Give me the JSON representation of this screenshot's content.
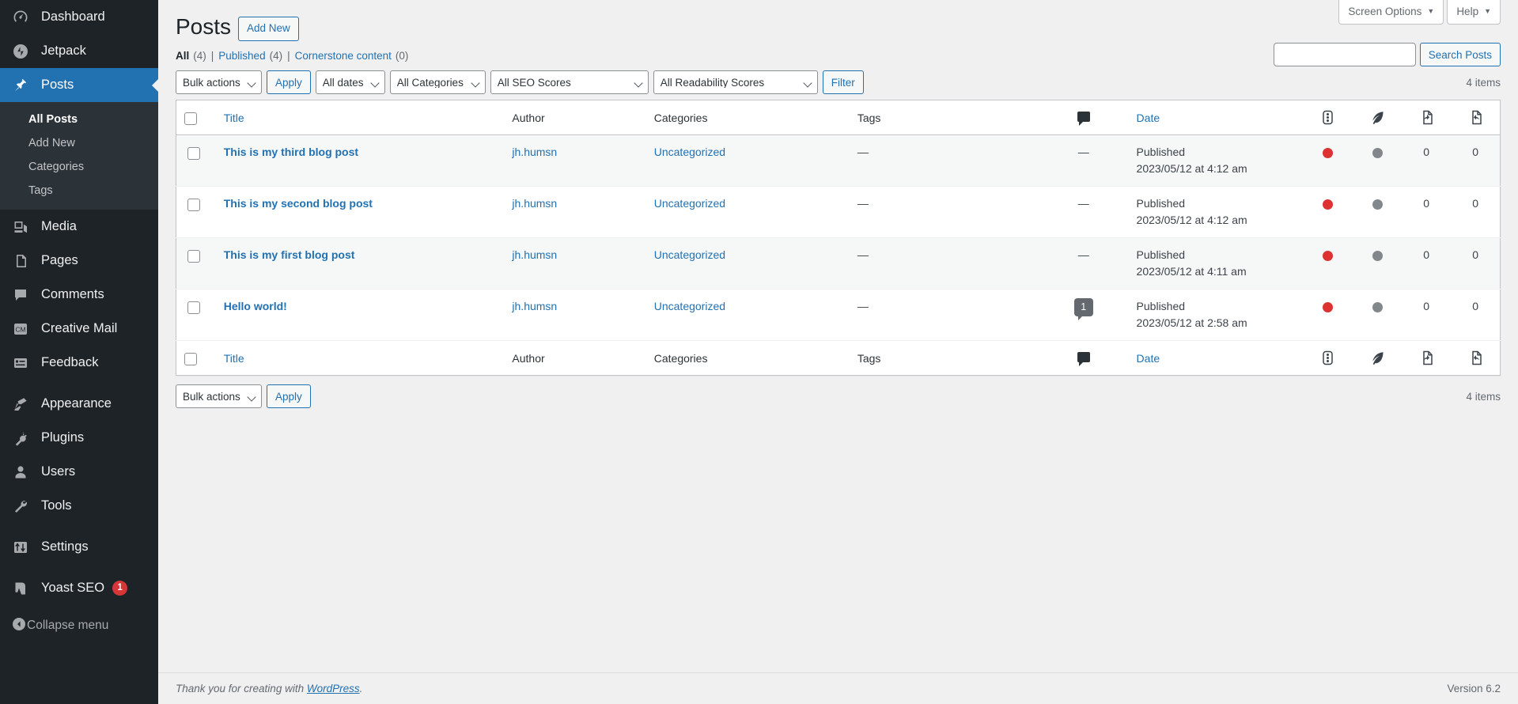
{
  "sidebar": {
    "items": [
      {
        "label": "Dashboard",
        "icon": "dashboard-icon",
        "current": false
      },
      {
        "label": "Jetpack",
        "icon": "jetpack-icon",
        "current": false
      },
      {
        "label": "Posts",
        "icon": "pin-icon",
        "current": true
      },
      {
        "label": "Media",
        "icon": "media-icon",
        "current": false
      },
      {
        "label": "Pages",
        "icon": "pages-icon",
        "current": false
      },
      {
        "label": "Comments",
        "icon": "comments-icon",
        "current": false
      },
      {
        "label": "Creative Mail",
        "icon": "creative-mail-icon",
        "current": false
      },
      {
        "label": "Feedback",
        "icon": "feedback-icon",
        "current": false
      },
      {
        "label": "Appearance",
        "icon": "appearance-icon",
        "current": false
      },
      {
        "label": "Plugins",
        "icon": "plugins-icon",
        "current": false
      },
      {
        "label": "Users",
        "icon": "users-icon",
        "current": false
      },
      {
        "label": "Tools",
        "icon": "tools-icon",
        "current": false
      },
      {
        "label": "Settings",
        "icon": "settings-icon",
        "current": false
      },
      {
        "label": "Yoast SEO",
        "icon": "yoast-icon",
        "current": false,
        "badge": "1"
      }
    ],
    "submenu": [
      {
        "label": "All Posts",
        "current": true
      },
      {
        "label": "Add New",
        "current": false
      },
      {
        "label": "Categories",
        "current": false
      },
      {
        "label": "Tags",
        "current": false
      }
    ],
    "collapse_label": "Collapse menu"
  },
  "screen_meta": {
    "screen_options": "Screen Options",
    "help": "Help",
    "caret": "▼"
  },
  "header": {
    "title": "Posts",
    "add_new": "Add New"
  },
  "views": [
    {
      "label": "All",
      "count": "(4)",
      "current": true
    },
    {
      "label": "Published",
      "count": "(4)",
      "current": false
    },
    {
      "label": "Cornerstone content",
      "count": "(0)",
      "current": false
    }
  ],
  "search": {
    "value": "",
    "placeholder": "",
    "button": "Search Posts"
  },
  "tablenav_top": {
    "bulk_actions": "Bulk actions",
    "apply": "Apply",
    "dates": "All dates",
    "categories": "All Categories",
    "seo_scores": "All SEO Scores",
    "readability_scores": "All Readability Scores",
    "filter": "Filter",
    "displaying_num": "4 items"
  },
  "tablenav_bottom": {
    "bulk_actions": "Bulk actions",
    "apply": "Apply",
    "displaying_num": "4 items"
  },
  "table": {
    "columns": {
      "title": "Title",
      "author": "Author",
      "categories": "Categories",
      "tags": "Tags",
      "comments": "comments-icon",
      "date": "Date",
      "seo": "seo-score-icon",
      "readability": "readability-feather-icon",
      "linked": "incoming-links-icon",
      "links": "outgoing-links-icon"
    },
    "rows": [
      {
        "title": "This is my third blog post",
        "author": "jh.humsn",
        "categories": "Uncategorized",
        "tags": "—",
        "comments": "—",
        "comment_count": null,
        "date_status": "Published",
        "date_value": "2023/05/12 at 4:12 am",
        "seo_color": "#dc3232",
        "readability_color": "#82878c",
        "linked": "0",
        "links": "0"
      },
      {
        "title": "This is my second blog post",
        "author": "jh.humsn",
        "categories": "Uncategorized",
        "tags": "—",
        "comments": "—",
        "comment_count": null,
        "date_status": "Published",
        "date_value": "2023/05/12 at 4:12 am",
        "seo_color": "#dc3232",
        "readability_color": "#82878c",
        "linked": "0",
        "links": "0"
      },
      {
        "title": "This is my first blog post",
        "author": "jh.humsn",
        "categories": "Uncategorized",
        "tags": "—",
        "comments": "—",
        "comment_count": null,
        "date_status": "Published",
        "date_value": "2023/05/12 at 4:11 am",
        "seo_color": "#dc3232",
        "readability_color": "#82878c",
        "linked": "0",
        "links": "0"
      },
      {
        "title": "Hello world!",
        "author": "jh.humsn",
        "categories": "Uncategorized",
        "tags": "—",
        "comments": "",
        "comment_count": "1",
        "date_status": "Published",
        "date_value": "2023/05/12 at 2:58 am",
        "seo_color": "#dc3232",
        "readability_color": "#82878c",
        "linked": "0",
        "links": "0"
      }
    ]
  },
  "footer": {
    "thanks_prefix": "Thank you for creating with ",
    "wordpress": "WordPress",
    "thanks_suffix": ".",
    "version": "Version 6.2"
  },
  "colors": {
    "sidebar_bg": "#1d2327",
    "sidebar_submenu_bg": "#2c3338",
    "accent": "#2271b1",
    "badge": "#d63638",
    "seo_red": "#dc3232",
    "readability_gray": "#82878c"
  }
}
